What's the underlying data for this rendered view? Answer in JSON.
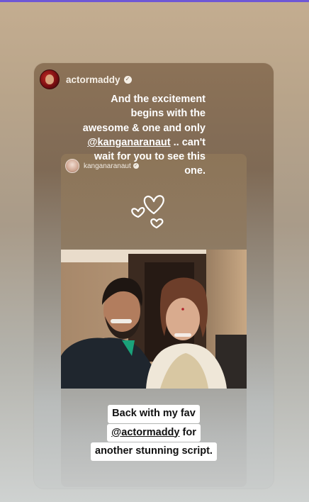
{
  "story": {
    "progress_color": "#6e57d6",
    "outer_post": {
      "username": "actormaddy",
      "verified_icon": "verified-badge-icon",
      "caption_lines": [
        [
          "And the excitement"
        ],
        [
          "begins  with the"
        ],
        [
          "awesome & one and only"
        ],
        [
          "@",
          "kanganaranaut",
          " .. can't"
        ],
        [
          "wait for you to see this"
        ],
        [
          "one."
        ]
      ]
    },
    "inner_post": {
      "username": "kanganaranaut",
      "verified_icon": "verified-badge-icon",
      "sticker": "hearts-doodle-icon",
      "photo_description": "selfie-photo",
      "caption_lines": [
        [
          "Back with my fav"
        ],
        [
          "@",
          "actormaddy",
          " for"
        ],
        [
          "another stunning script."
        ]
      ]
    }
  }
}
